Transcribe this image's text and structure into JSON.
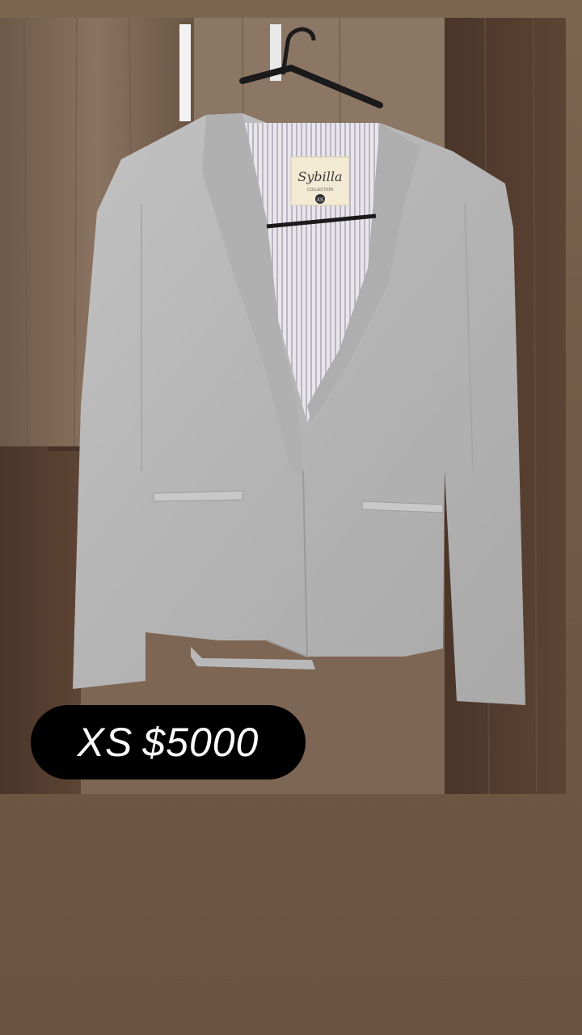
{
  "story": {
    "background_color": "#6f5a45",
    "photo": {
      "subject": "grey-blazer-on-hanger",
      "brand_label_text": "Sybilla",
      "brand_label_subtext": "COLLECTION",
      "size_tag_text": "XS"
    },
    "price_sticker": {
      "size": "XS",
      "price": "$5000",
      "background_color": "#000000",
      "text_color": "#ffffff"
    }
  }
}
